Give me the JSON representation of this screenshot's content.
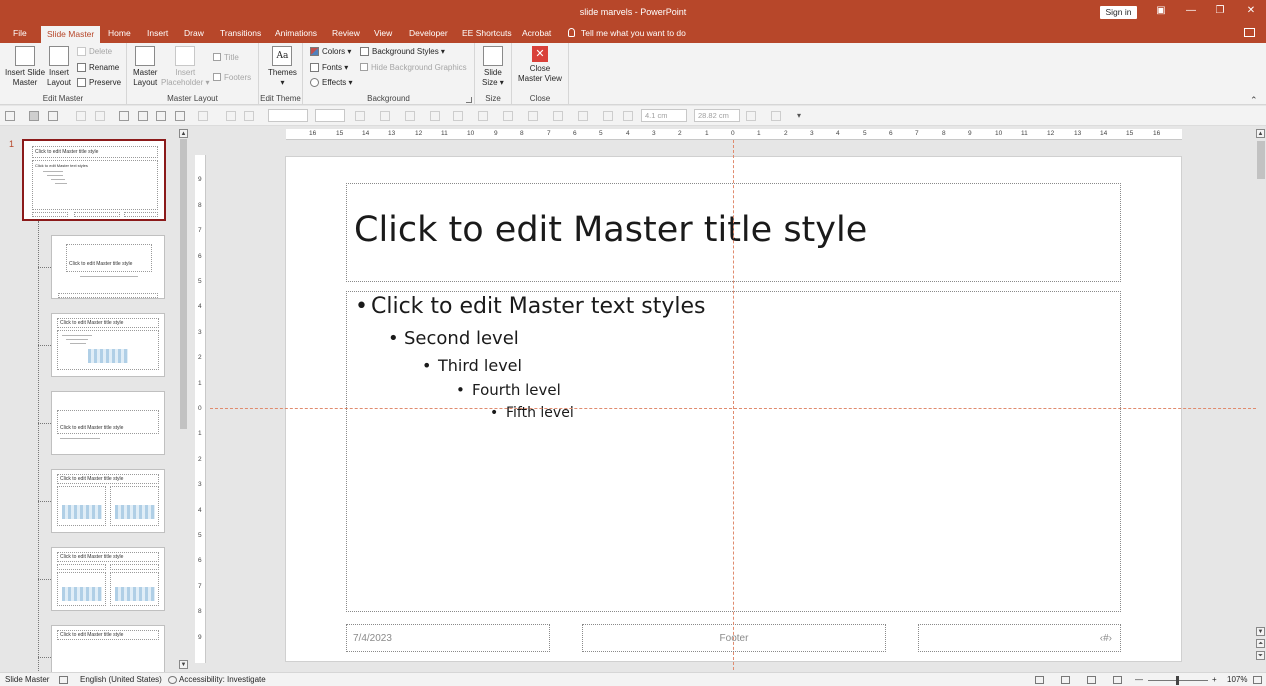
{
  "window": {
    "title": "slide marvels  -  PowerPoint",
    "signin": "Sign in",
    "minimize": "—",
    "restore": "❐",
    "close": "✕"
  },
  "tabs": [
    {
      "label": "File"
    },
    {
      "label": "Slide Master"
    },
    {
      "label": "Home"
    },
    {
      "label": "Insert"
    },
    {
      "label": "Draw"
    },
    {
      "label": "Transitions"
    },
    {
      "label": "Animations"
    },
    {
      "label": "Review"
    },
    {
      "label": "View"
    },
    {
      "label": "Developer"
    },
    {
      "label": "EE Shortcuts"
    },
    {
      "label": "Acrobat"
    }
  ],
  "tellme": "Tell me what you want to do",
  "ribbon": {
    "edit_master": {
      "label": "Edit Master",
      "insert_slide_master": [
        "Insert Slide",
        "Master"
      ],
      "insert_layout": [
        "Insert",
        "Layout"
      ],
      "delete": "Delete",
      "rename": "Rename",
      "preserve": "Preserve"
    },
    "master_layout": {
      "label": "Master Layout",
      "master_layout_btn": [
        "Master",
        "Layout"
      ],
      "insert_placeholder": [
        "Insert",
        "Placeholder ▾"
      ],
      "title": "Title",
      "footers": "Footers"
    },
    "edit_theme": {
      "label": "Edit Theme",
      "themes": "Themes",
      "aa": "Aa"
    },
    "background": {
      "label": "Background",
      "colors": "Colors ▾",
      "fonts": "Fonts ▾",
      "effects": "Effects ▾",
      "background_styles": "Background Styles ▾",
      "hide_bg": "Hide Background Graphics"
    },
    "size": {
      "label": "Size",
      "slide_size": [
        "Slide",
        "Size ▾"
      ]
    },
    "close": {
      "label": "Close",
      "close_master": [
        "Close",
        "Master View"
      ]
    }
  },
  "toolbar": {
    "width_value": "4.1 cm",
    "height_value": "28.82 cm"
  },
  "ruler": {
    "h_ticks": [
      "16",
      "15",
      "14",
      "13",
      "12",
      "11",
      "10",
      "9",
      "8",
      "7",
      "6",
      "5",
      "4",
      "3",
      "2",
      "1",
      "0",
      "1",
      "2",
      "3",
      "4",
      "5",
      "6",
      "7",
      "8",
      "9",
      "10",
      "11",
      "12",
      "13",
      "14",
      "15",
      "16"
    ],
    "v_ticks": [
      "9",
      "8",
      "7",
      "6",
      "5",
      "4",
      "3",
      "2",
      "1",
      "0",
      "1",
      "2",
      "3",
      "4",
      "5",
      "6",
      "7",
      "8",
      "9"
    ]
  },
  "thumbnails": {
    "number": "1",
    "master_title": "Click to edit Master title style",
    "master_text": "Click to edit Master text styles",
    "layout_title": "Click to edit Master title style"
  },
  "slide": {
    "title": "Click to edit Master title style",
    "levels": [
      "Click to edit Master text styles",
      "Second level",
      "Third level",
      "Fourth level",
      "Fifth level"
    ],
    "date": "7/4/2023",
    "footer": "Footer",
    "number": "‹#›"
  },
  "status": {
    "view": "Slide Master",
    "language": "English (United States)",
    "accessibility": "Accessibility: Investigate",
    "zoom": "107%",
    "zoom_minus": "—",
    "zoom_plus": "+"
  },
  "colors": {
    "accent": "#b7472a",
    "selected_thumb": "#8b1a1a",
    "guide": "#e08b6e"
  }
}
